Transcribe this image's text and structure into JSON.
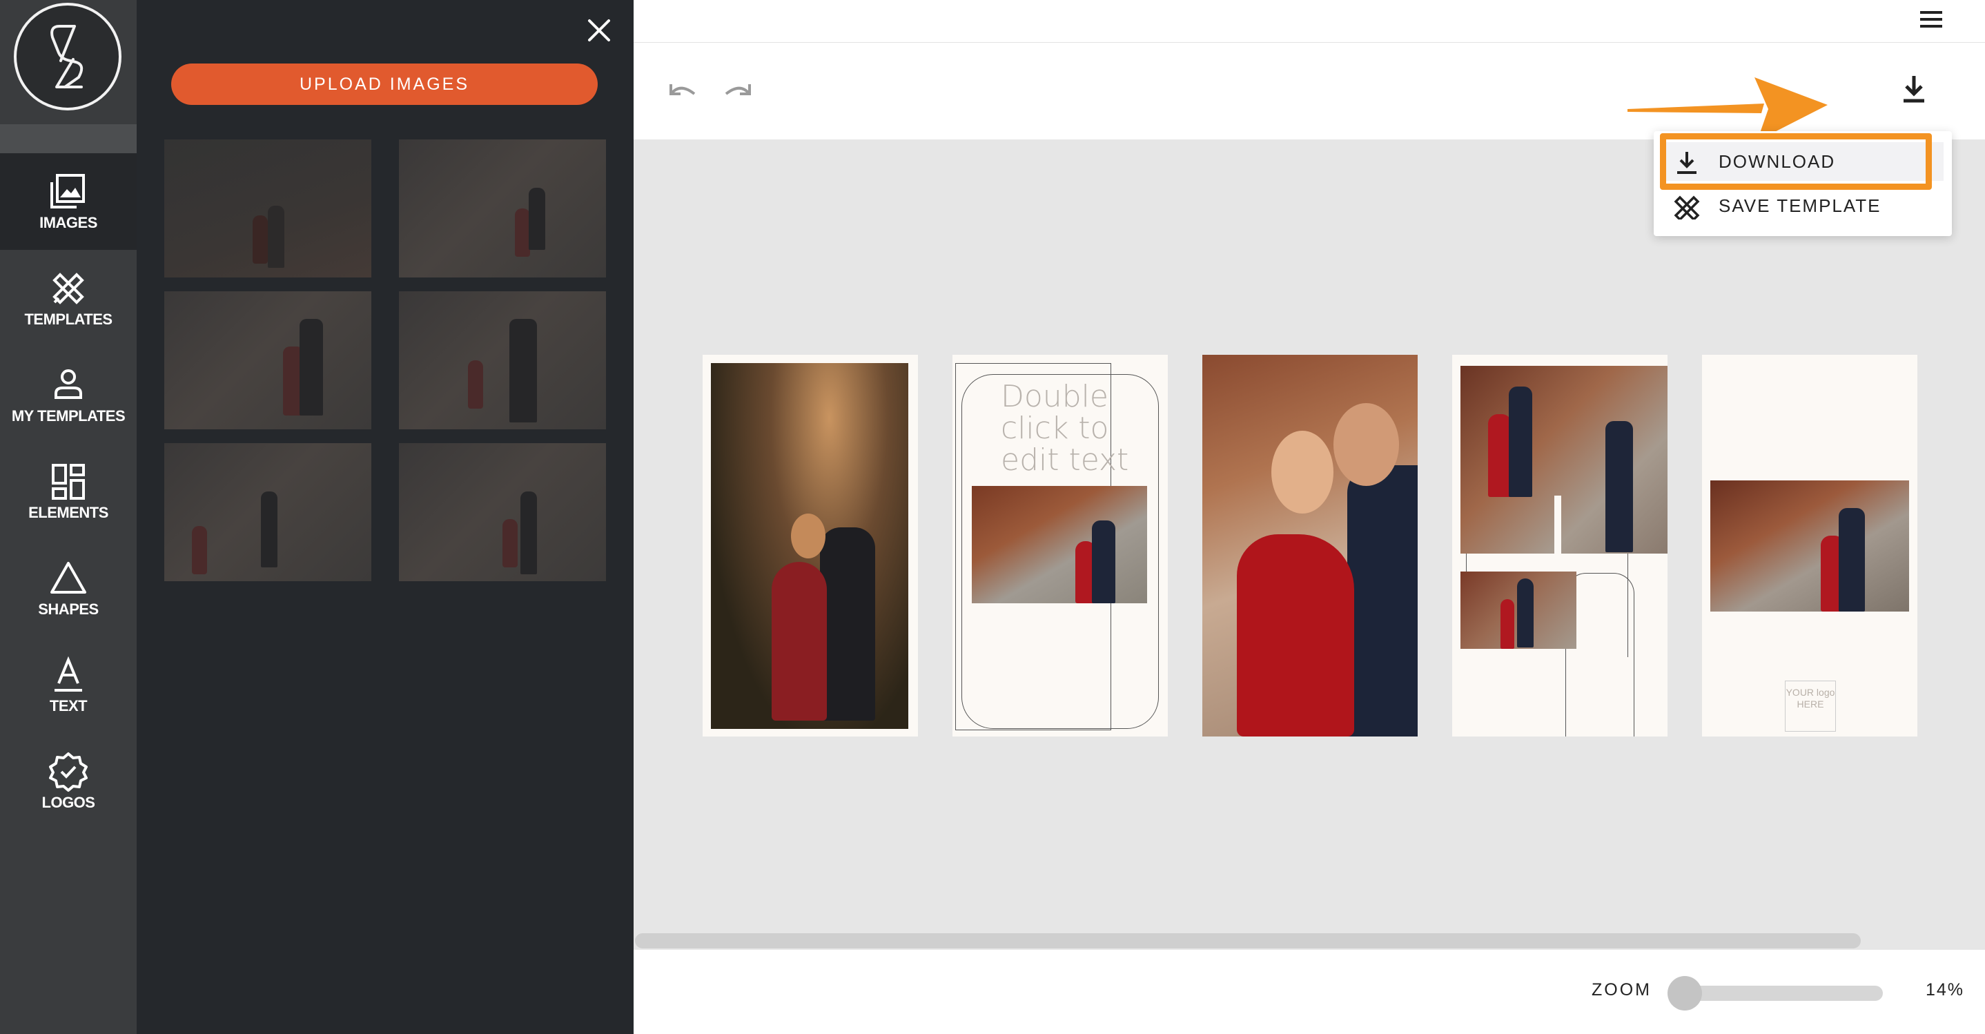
{
  "sidebar": {
    "items": [
      {
        "label": "IMAGES",
        "icon": "images-icon"
      },
      {
        "label": "TEMPLATES",
        "icon": "templates-icon"
      },
      {
        "label": "MY TEMPLATES",
        "icon": "user-icon"
      },
      {
        "label": "ELEMENTS",
        "icon": "elements-icon"
      },
      {
        "label": "SHAPES",
        "icon": "triangle-icon"
      },
      {
        "label": "TEXT",
        "icon": "text-icon"
      },
      {
        "label": "LOGOS",
        "icon": "badge-icon"
      }
    ]
  },
  "panel": {
    "upload_label": "UPLOAD IMAGES"
  },
  "dropdown": {
    "download_label": "DOWNLOAD",
    "save_template_label": "SAVE TEMPLATE"
  },
  "canvas": {
    "slide2_text": "Double click to edit text",
    "slide5_logo_text": "YOUR logo HERE"
  },
  "zoom": {
    "label": "ZOOM",
    "value": "14%",
    "level": 0.14
  },
  "colors": {
    "accent": "#e15a2e",
    "annotation": "#f39322"
  }
}
